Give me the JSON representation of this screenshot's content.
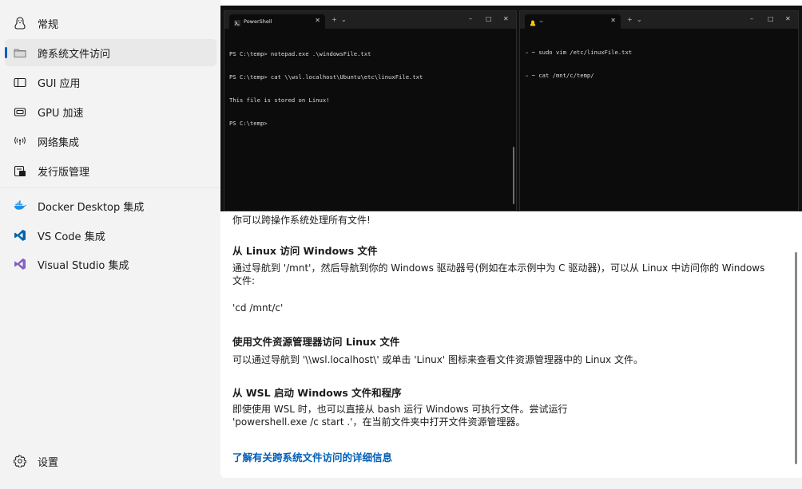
{
  "sidebar": {
    "items": [
      {
        "label": "常规",
        "icon": "penguin-icon"
      },
      {
        "label": "跨系统文件访问",
        "icon": "folder-icon",
        "selected": true
      },
      {
        "label": "GUI 应用",
        "icon": "window-icon"
      },
      {
        "label": "GPU 加速",
        "icon": "gpu-icon"
      },
      {
        "label": "网络集成",
        "icon": "network-icon"
      },
      {
        "label": "发行版管理",
        "icon": "distro-icon"
      },
      {
        "label": "Docker Desktop 集成",
        "icon": "docker-icon"
      },
      {
        "label": "VS Code 集成",
        "icon": "vscode-icon"
      },
      {
        "label": "Visual Studio 集成",
        "icon": "visual-studio-icon"
      }
    ],
    "settings": {
      "label": "设置",
      "icon": "gear-icon"
    }
  },
  "terminals": {
    "left": {
      "tab_title": "PowerShell",
      "lines": [
        "PS C:\\temp> notepad.exe .\\windowsFile.txt",
        "PS C:\\temp> cat \\\\wsl.localhost\\Ubuntu\\etc\\linuxFile.txt",
        "This file is stored on Linux!",
        "PS C:\\temp>"
      ]
    },
    "right": {
      "tab_title": "~",
      "lines": [
        "~ sudo vim /etc/linuxFile.txt",
        "~ cat /mnt/c/temp/"
      ]
    }
  },
  "content": {
    "intro": "你可以跨操作系统处理所有文件!",
    "sections": [
      {
        "title": "从 Linux 访问 Windows 文件",
        "body_line1": "通过导航到 '/mnt'，然后导航到你的 Windows 驱动器号(例如在本示例中为 C 驱动器)，可以从 Linux 中访问你的 Windows",
        "body_line2": "文件:",
        "code": "'cd /mnt/c'"
      },
      {
        "title": "使用文件资源管理器访问 Linux 文件",
        "body_line1": "可以通过导航到 '\\\\wsl.localhost\\' 或单击 'Linux' 图标来查看文件资源管理器中的 Linux 文件。"
      },
      {
        "title": "从 WSL 启动 Windows 文件和程序",
        "body_line1": "即使使用 WSL 时，也可以直接从 bash 运行 Windows 可执行文件。尝试运行",
        "body_line2": "'powershell.exe /c start .'，在当前文件夹中打开文件资源管理器。"
      }
    ],
    "learn_more": "了解有关跨系统文件访问的详细信息"
  },
  "colors": {
    "accent": "#005fb8",
    "terminal_bg": "#0c0c0c",
    "prompt_arrow": "#16c60c"
  }
}
